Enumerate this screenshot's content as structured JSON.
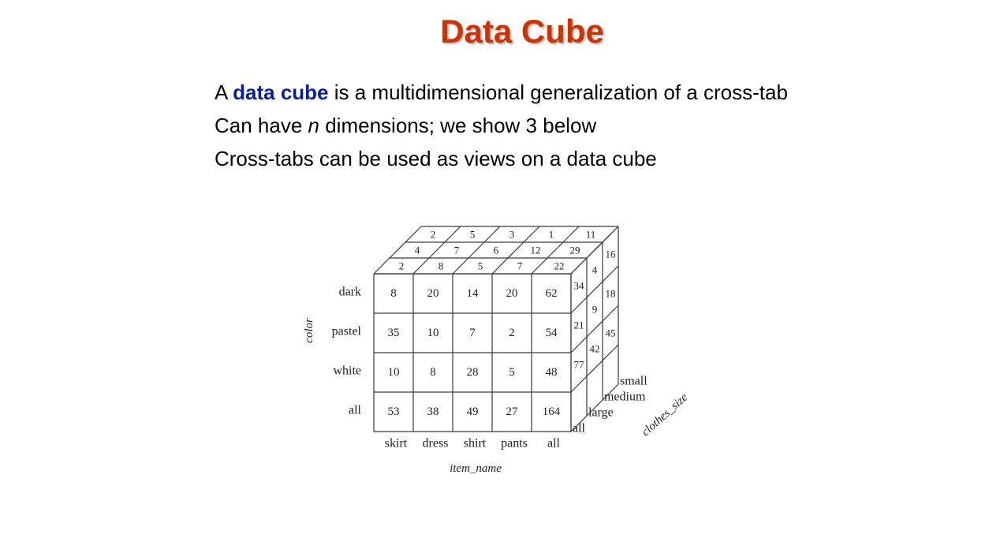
{
  "slide": {
    "title": "Data Cube",
    "bullet1": {
      "pre": "A ",
      "highlight": "data cube",
      "post": " is a multidimensional generalization of a cross-tab"
    },
    "bullet2": {
      "pre": "Can have ",
      "var": "n",
      "post": " dimensions; we show 3 below"
    },
    "bullet3": "Cross-tabs can be used as views on a data cube",
    "highlight_color": "#0a1f9e",
    "title_color": "#cc3300"
  },
  "cube": {
    "axis_color": "color",
    "axis_item": "item_name",
    "axis_size": "clothes_size",
    "rows": [
      "dark",
      "pastel",
      "white",
      "all"
    ],
    "cols": [
      "skirt",
      "dress",
      "shirt",
      "pants",
      "all"
    ],
    "sizes": [
      "small",
      "medium",
      "large",
      "all"
    ],
    "front": [
      [
        "8",
        "20",
        "14",
        "20",
        "62"
      ],
      [
        "35",
        "10",
        "7",
        "2",
        "54"
      ],
      [
        "10",
        "8",
        "28",
        "5",
        "48"
      ],
      [
        "53",
        "38",
        "49",
        "27",
        "164"
      ]
    ],
    "top": [
      [
        "2",
        "5",
        "3",
        "1",
        "11"
      ],
      [
        "4",
        "7",
        "6",
        "12",
        "29"
      ],
      [
        "2",
        "8",
        "5",
        "7",
        "22"
      ]
    ],
    "right": [
      [
        "34",
        "4",
        "16"
      ],
      [
        "21",
        "9",
        "18"
      ],
      [
        "77",
        "42",
        "45"
      ]
    ]
  }
}
